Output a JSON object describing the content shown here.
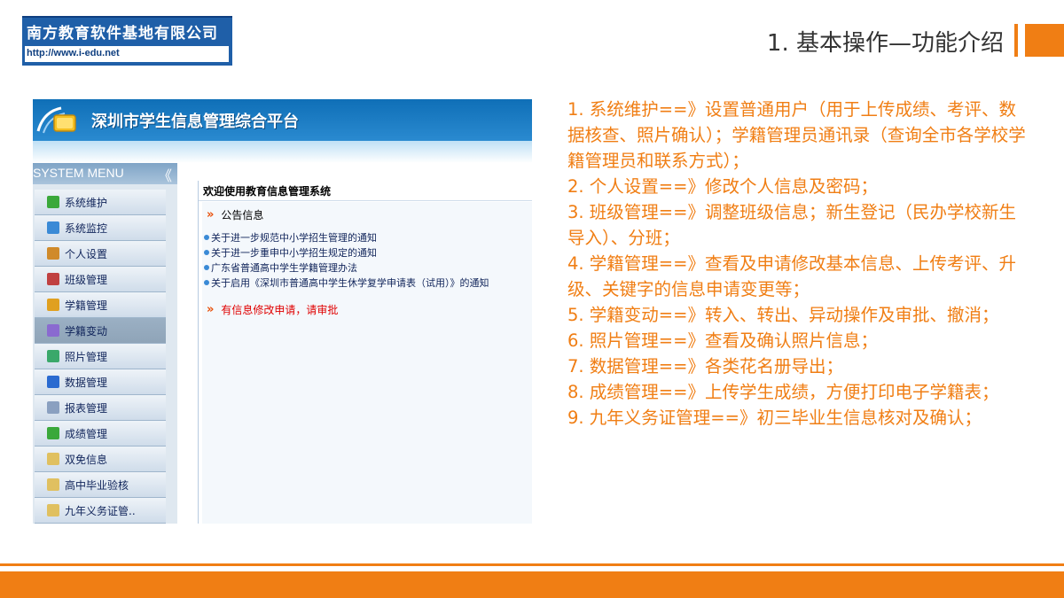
{
  "logo": {
    "company": "南方教育软件基地有限公司",
    "url": "http://www.i-edu.net"
  },
  "slide_title": "1. 基本操作—功能介绍",
  "accent_color": "#f07e14",
  "app": {
    "title": "深圳市学生信息管理综合平台",
    "system_menu_label": "SYSTEM MENU",
    "collapse_icon": "《",
    "menu": [
      {
        "label": "系统维护",
        "icon": "leaf-icon",
        "color": "#3aa83a"
      },
      {
        "label": "系统监控",
        "icon": "monitor-icon",
        "color": "#3a8ad6"
      },
      {
        "label": "个人设置",
        "icon": "card-icon",
        "color": "#d08a2a"
      },
      {
        "label": "班级管理",
        "icon": "class-icon",
        "color": "#c04040"
      },
      {
        "label": "学籍管理",
        "icon": "student-icon",
        "color": "#e0a020"
      },
      {
        "label": "学籍变动",
        "icon": "transfer-icon",
        "color": "#8a6ad0",
        "active": true
      },
      {
        "label": "照片管理",
        "icon": "photo-icon",
        "color": "#3aa86a"
      },
      {
        "label": "数据管理",
        "icon": "data-icon",
        "color": "#2a6ad0"
      },
      {
        "label": "报表管理",
        "icon": "report-icon",
        "color": "#8aa0c0"
      },
      {
        "label": "成绩管理",
        "icon": "score-icon",
        "color": "#3aa83a"
      },
      {
        "label": "双免信息",
        "icon": "folder-icon",
        "color": "#e0c060"
      },
      {
        "label": "高中毕业验核",
        "icon": "folder-icon",
        "color": "#e0c060"
      },
      {
        "label": "九年义务证管..",
        "icon": "folder-icon",
        "color": "#e0c060"
      }
    ],
    "welcome": "欢迎使用教育信息管理系统",
    "notice_header": "公告信息",
    "chevron": "»",
    "notices": [
      "关于进一步规范中小学招生管理的通知",
      "关于进一步重申中小学招生规定的通知",
      "广东省普通高中学生学籍管理办法",
      "关于启用《深圳市普通高中学生休学复学申请表（试用）》的通知"
    ],
    "alert": "有信息修改申请，请审批"
  },
  "descriptions": [
    "1. 系统维护==》设置普通用户（用于上传成绩、考评、数据核查、照片确认）；学籍管理员通讯录（查询全市各学校学籍管理员和联系方式）；",
    "2. 个人设置==》修改个人信息及密码；",
    "3. 班级管理==》调整班级信息；新生登记（民办学校新生导入）、分班；",
    "4. 学籍管理==》查看及申请修改基本信息、上传考评、升级、关键字的信息申请变更等；",
    "5. 学籍变动==》转入、转出、异动操作及审批、撤消；",
    "6. 照片管理==》查看及确认照片信息；",
    "7. 数据管理==》各类花名册导出；",
    "8. 成绩管理==》上传学生成绩，方便打印电子学籍表；",
    "9. 九年义务证管理==》初三毕业生信息核对及确认；"
  ]
}
